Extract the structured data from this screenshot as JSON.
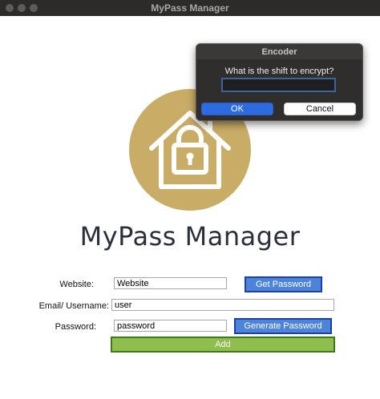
{
  "window": {
    "title": "MyPass Manager"
  },
  "logo": {
    "icon": "house-lock-icon",
    "badge_color": "#c9ad67",
    "wordmark": "MyPass Manager"
  },
  "form": {
    "website": {
      "label": "Website:",
      "value": "Website"
    },
    "email": {
      "label": "Email/ Username:",
      "value": "user"
    },
    "password": {
      "label": "Password:",
      "value": "password"
    },
    "get_password_label": "Get Password",
    "generate_password_label": "Generate Password",
    "add_label": "Add"
  },
  "dialog": {
    "title": "Encoder",
    "prompt": "What is the shift to encrypt?",
    "input_value": "",
    "ok_label": "OK",
    "cancel_label": "Cancel"
  },
  "colors": {
    "blue_button": "#4b84d9",
    "green_button": "#8fbd4e",
    "dialog_ok": "#2e6be0"
  }
}
